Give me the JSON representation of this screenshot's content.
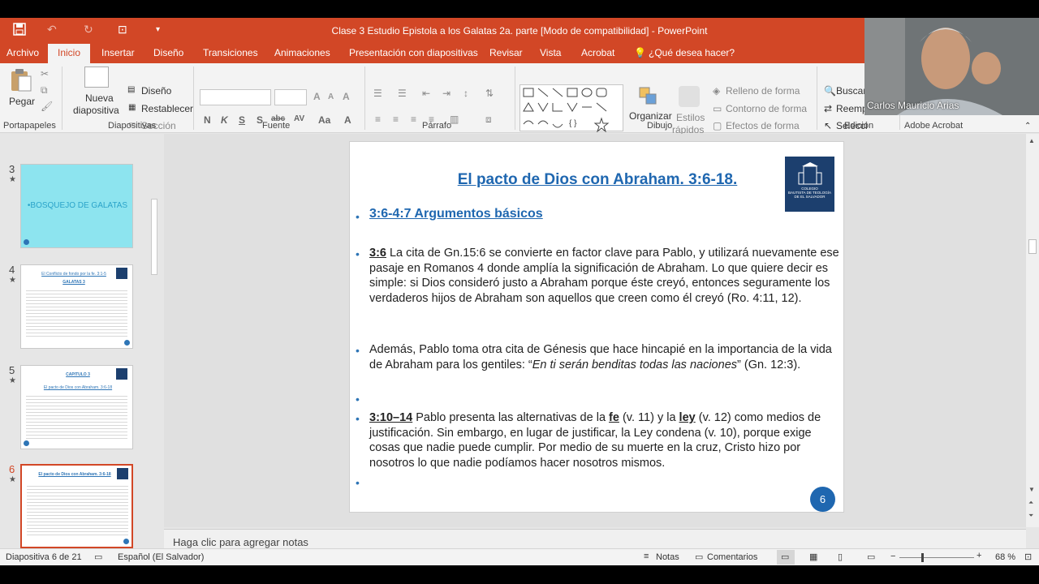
{
  "window": {
    "title": "Clase 3 Estudio Epistola a los Galatas 2a. parte [Modo de compatibilidad] - PowerPoint"
  },
  "tabs": [
    "Archivo",
    "Inicio",
    "Insertar",
    "Diseño",
    "Transiciones",
    "Animaciones",
    "Presentación con diapositivas",
    "Revisar",
    "Vista",
    "Acrobat"
  ],
  "tell_me": "¿Qué desea hacer?",
  "ribbon": {
    "paste": "Pegar",
    "new_slide_1": "Nueva",
    "new_slide_2": "diapositiva",
    "layout": "Diseño",
    "reset": "Restablecer",
    "section": "Sección",
    "arrange": "Organizar",
    "styles_1": "Estilos",
    "styles_2": "rápidos",
    "shape_fill": "Relleno de forma",
    "shape_outline": "Contorno de forma",
    "shape_effects": "Efectos de forma",
    "find": "Buscar",
    "replace": "Reemp",
    "select": "Selecci",
    "font_btns": [
      "N",
      "K",
      "S",
      "S",
      "abc",
      "AV",
      "Aa",
      "A"
    ]
  },
  "groups": [
    "Portapapeles",
    "Diapositivas",
    "Fuente",
    "Párrafo",
    "Dibujo",
    "Edición",
    "Adobe Acrobat"
  ],
  "webcam": {
    "name": "Carlos Mauricio Arias"
  },
  "thumbnails": [
    {
      "num": "3",
      "star": "★",
      "text": "•BOSQUEJO DE GALATAS"
    },
    {
      "num": "4",
      "star": "★",
      "title": "El Conflicto de fondo por la fe.   3:1-5",
      "subtitle": "GALATAS 3"
    },
    {
      "num": "5",
      "star": "★",
      "title": "CAPITULO 3",
      "subtitle": "El pacto de Dios con Abraham.  3:6-18"
    },
    {
      "num": "6",
      "star": "★",
      "title": "El pacto de Dios con Abraham.   3:6-18"
    }
  ],
  "slide": {
    "title": "El pacto de Dios con Abraham.  3:6-18.",
    "logo_text": [
      "COLEGIO",
      "BAUTISTA DE TEOLOGÍA",
      "DE EL SALVADOR"
    ],
    "heading": "3:6-4:7 Argumentos básicos",
    "p1_ref": "3:6",
    "p1": " La cita de Gn.15:6 se convierte en factor clave para Pablo, y utilizará nuevamente ese pasaje en Romanos 4 donde amplía la significación de Abraham. Lo que quiere decir es simple: si Dios consideró justo a Abraham porque éste creyó, entonces seguramente los verdaderos hijos de Abraham son aquellos que creen como él creyó (Ro. 4:11, 12).",
    "p2_a": "Además, Pablo toma otra cita de Génesis que hace hincapié en la importancia de la vida de Abraham para los gentiles: “",
    "p2_italic": "En ti serán benditas todas las naciones",
    "p2_b": "” (Gn. 12:3).",
    "p3_ref": "3:10–14",
    "p3_a": " Pablo presenta las alternativas de la ",
    "p3_fe": "fe",
    "p3_b": " (v. 11) y la ",
    "p3_ley": "ley",
    "p3_c": " (v. 12) como medios de justificación. Sin embargo, en lugar de justificar, la Ley condena (v. 10), porque exige cosas que nadie puede cumplir. Por medio de su muerte en la cruz, Cristo hizo por nosotros lo que nadie podíamos hacer nosotros mismos.",
    "page_num": "6"
  },
  "notes_placeholder": "Haga clic para agregar notas",
  "status": {
    "slide_of": "Diapositiva 6 de 21",
    "language": "Español (El Salvador)",
    "notes": "Notas",
    "comments": "Comentarios",
    "zoom": "68 %"
  }
}
